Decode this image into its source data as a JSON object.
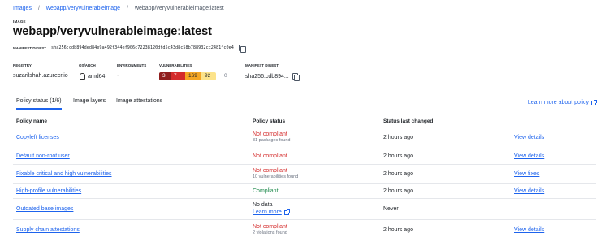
{
  "breadcrumb": {
    "items": [
      "Images",
      "webapp/veryvulnerableimage"
    ],
    "current": "webapp/veryvulnerableimage:latest",
    "separator": "/"
  },
  "image": {
    "eyebrow": "IMAGE",
    "title": "webapp/veryvulnerableimage:latest",
    "manifest_digest_label": "MANIFEST DIGEST",
    "manifest_digest": "sha256:cdb894ded84e9a492f344ef906c72238120dfd5c43d8c58b788932cc2481fc0e4"
  },
  "meta": {
    "registry_label": "REGISTRY",
    "registry": "suzarilshah.azurecr.io",
    "os_arch_label": "OS/ARCH",
    "os_arch": "amd64",
    "environments_label": "ENVIRONMENTS",
    "environments": "-",
    "vulnerabilities_label": "VULNERABILITIES",
    "vulnerabilities": {
      "critical": "3",
      "high": "7",
      "medium": "169",
      "low": "92",
      "unspecified": "0"
    },
    "manifest_digest_label": "MANIFEST DIGEST",
    "manifest_digest_short": "sha256:cdb894..."
  },
  "tabs": [
    {
      "label": "Policy status (1/6)",
      "active": true
    },
    {
      "label": "Image layers",
      "active": false
    },
    {
      "label": "Image attestations",
      "active": false
    }
  ],
  "learn_more_policy": "Learn more about policy",
  "table": {
    "headers": [
      "Policy name",
      "Policy status",
      "Status last changed"
    ],
    "rows": [
      {
        "name": "Copyleft licenses",
        "status": "Not compliant",
        "detail": "31 packages found",
        "changed": "2 hours ago",
        "action": "View details"
      },
      {
        "name": "Default non-root user",
        "status": "Not compliant",
        "detail": "",
        "changed": "2 hours ago",
        "action": "View details"
      },
      {
        "name": "Fixable critical and high vulnerabilities",
        "status": "Not compliant",
        "detail": "10 vulnerabilities found",
        "changed": "2 hours ago",
        "action": "View fixes"
      },
      {
        "name": "High-profile vulnerabilities",
        "status": "Compliant",
        "detail": "",
        "changed": "2 hours ago",
        "action": "View details"
      },
      {
        "name": "Outdated base images",
        "status": "No data",
        "detail": "Learn more",
        "changed": "Never",
        "action": ""
      },
      {
        "name": "Supply chain attestations",
        "status": "Not compliant",
        "detail": "2 violations found",
        "changed": "2 hours ago",
        "action": "View details"
      }
    ]
  },
  "colors": {
    "link": "#1d63ed",
    "critical": "#8f1d1d",
    "high": "#d42b2b",
    "medium": "#f5a623",
    "low": "#fce38a",
    "compliant": "#1e8a4c",
    "not_compliant": "#d42b2b"
  },
  "icons": [
    "copy-icon",
    "linux-icon",
    "external-link-icon"
  ]
}
